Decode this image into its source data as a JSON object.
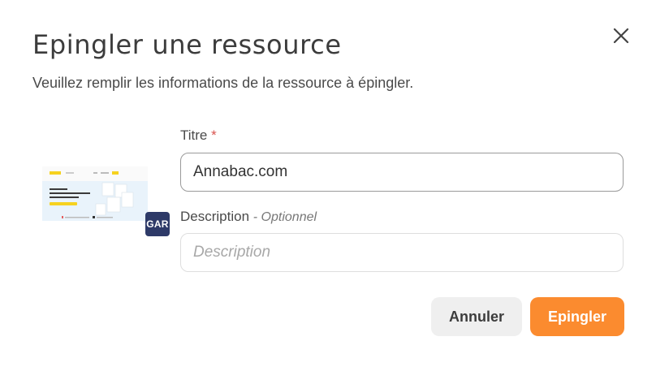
{
  "dialog": {
    "title": "Epingler une ressource",
    "subtitle": "Veuillez remplir les informations de la ressource à épingler.",
    "close_icon": "close-icon"
  },
  "resource": {
    "thumbnail_icon": "site-preview-thumbnail",
    "badge": "GAR",
    "badge_color": "#2e3a68"
  },
  "form": {
    "title_label": "Titre",
    "required_mark": "*",
    "title_value": "Annabac.com",
    "description_label": "Description",
    "description_optional": "- Optionnel",
    "description_placeholder": "Description",
    "description_value": ""
  },
  "actions": {
    "cancel_label": "Annuler",
    "pin_label": "Epingler",
    "pin_color": "#fb8b2f"
  }
}
